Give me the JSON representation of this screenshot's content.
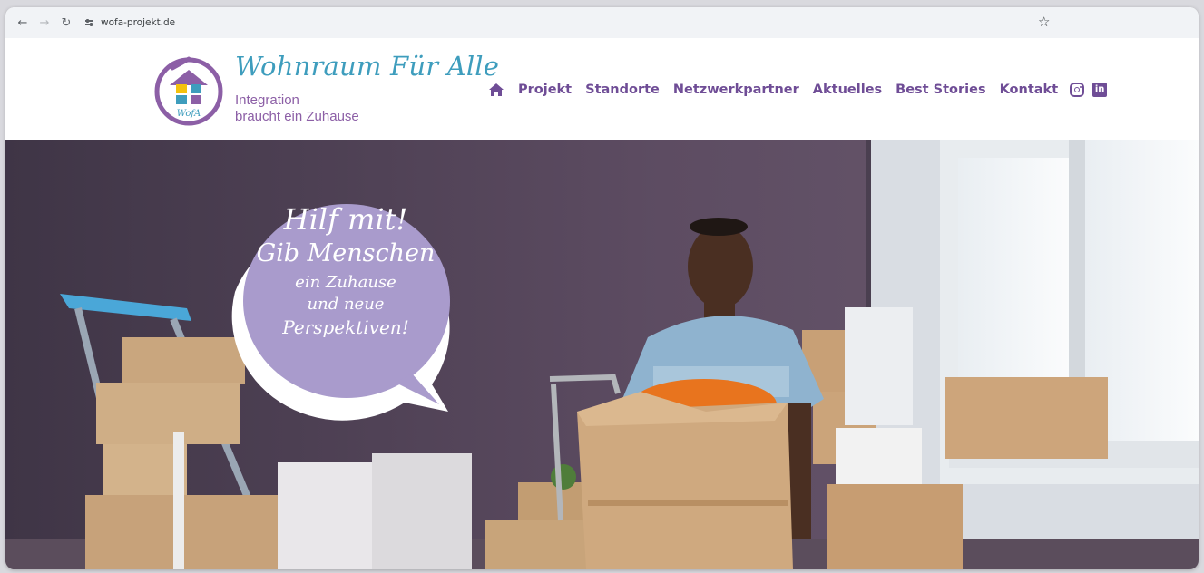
{
  "browser": {
    "url": "wofa-projekt.de",
    "icons": [
      "back-icon",
      "forward-icon",
      "reload-icon",
      "site-settings-icon",
      "bookmark-star-icon"
    ]
  },
  "brand": {
    "title": "Wohnraum Für Alle",
    "subtitle_line1": "Integration",
    "subtitle_line2": "braucht ein Zuhause",
    "logo_text": "WofA",
    "colors": {
      "teal": "#3e9dbd",
      "purple": "#8c5fa6",
      "nav": "#6f4d96",
      "yellow": "#f4c20d"
    }
  },
  "nav": {
    "items": [
      "Projekt",
      "Standorte",
      "Netzwerkpartner",
      "Aktuelles",
      "Best Stories",
      "Kontakt"
    ],
    "social": [
      "instagram",
      "linkedin"
    ],
    "linkedin_label": "in"
  },
  "hero": {
    "bubble": {
      "line1": "Hilf mit!",
      "line2": "Gib Menschen",
      "line3": "ein Zuhause",
      "line4": "und neue",
      "line5": "Perspektiven!",
      "color": "#a99bcc"
    },
    "wall_color": "#5a4a5f"
  }
}
